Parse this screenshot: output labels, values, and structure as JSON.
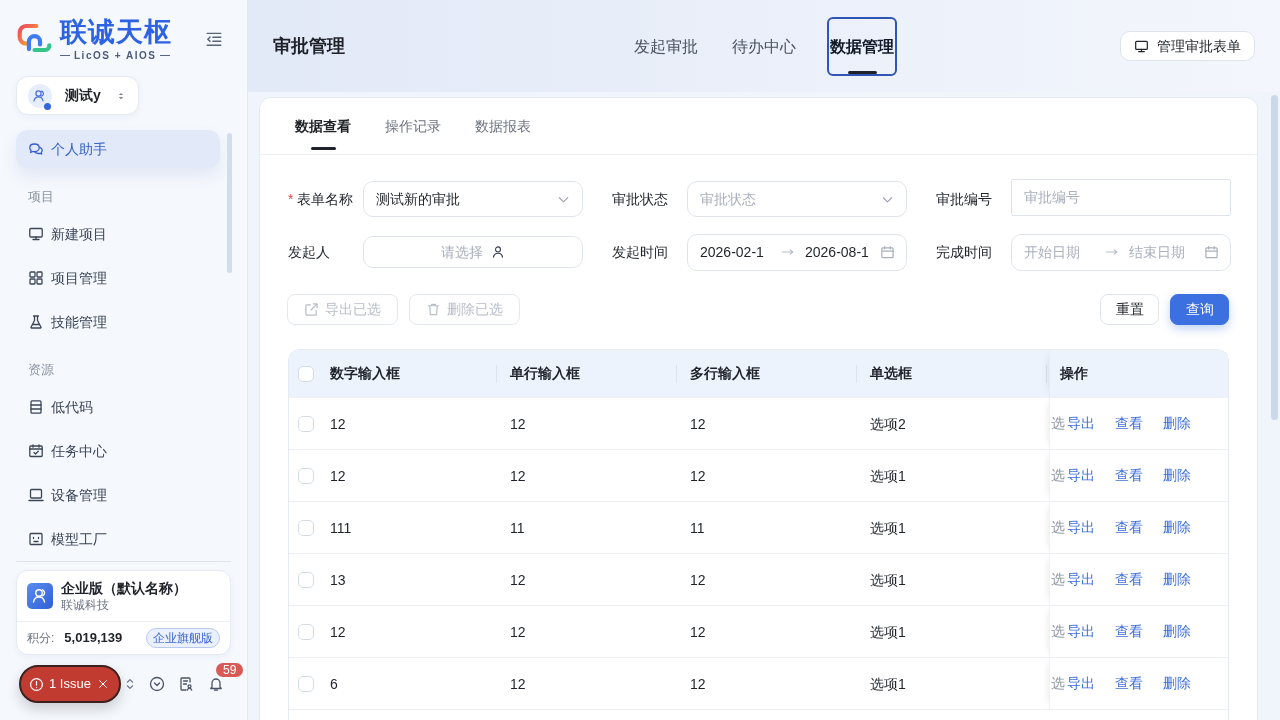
{
  "sidebar": {
    "logo": {
      "name": "联诚天枢",
      "tagline": "LicOS + AIOS"
    },
    "workspace": {
      "name": "测试y",
      "online": true
    },
    "nav": [
      {
        "kind": "item",
        "label": "个人助手",
        "selected": true
      },
      {
        "kind": "section",
        "label": "项目"
      },
      {
        "kind": "item",
        "label": "新建项目",
        "selected": false
      },
      {
        "kind": "item",
        "label": "项目管理",
        "selected": false
      },
      {
        "kind": "item",
        "label": "技能管理",
        "selected": false
      },
      {
        "kind": "section",
        "label": "资源"
      },
      {
        "kind": "item",
        "label": "低代码",
        "selected": false
      },
      {
        "kind": "item",
        "label": "任务中心",
        "selected": false
      },
      {
        "kind": "item",
        "label": "设备管理",
        "selected": false
      },
      {
        "kind": "item",
        "label": "模型工厂",
        "selected": false
      }
    ],
    "org_card": {
      "title": "企业版（默认名称）",
      "subtitle": "联诚科技",
      "points_label": "积分:",
      "points": "5,019,139",
      "plan": "企业旗舰版"
    },
    "notification_count": "59"
  },
  "issue_badge": {
    "label": "1 Issue"
  },
  "header": {
    "title": "审批管理",
    "tabs": [
      {
        "label": "发起审批",
        "selected": false
      },
      {
        "label": "待办中心",
        "selected": false
      },
      {
        "label": "数据管理",
        "selected": true
      }
    ],
    "action": "管理审批表单"
  },
  "subtabs": [
    {
      "label": "数据查看",
      "selected": true
    },
    {
      "label": "操作记录",
      "selected": false
    },
    {
      "label": "数据报表",
      "selected": false
    }
  ],
  "filters": [
    {
      "kind": "select",
      "required_mark": "*",
      "label": "表单名称",
      "value": "测试新的审批"
    },
    {
      "kind": "select",
      "label": "审批状态",
      "placeholder": "审批状态"
    },
    {
      "kind": "input",
      "label": "审批编号",
      "placeholder": "审批编号"
    },
    {
      "kind": "picker",
      "label": "发起人",
      "placeholder": "请选择"
    },
    {
      "kind": "range",
      "label": "发起时间",
      "start": "2026-02-1",
      "end": "2026-08-1"
    },
    {
      "kind": "range",
      "label": "完成时间",
      "start_placeholder": "开始日期",
      "end_placeholder": "结束日期"
    }
  ],
  "bulk_actions": [
    {
      "kind": "export",
      "label": "导出已选",
      "disabled": true
    },
    {
      "kind": "delete",
      "label": "删除已选",
      "disabled": true
    }
  ],
  "search_actions": [
    {
      "kind": "default",
      "label": "重置"
    },
    {
      "kind": "primary",
      "label": "查询"
    }
  ],
  "table": {
    "all_checked": false,
    "columns": [
      "数字输入框",
      "单行输入框",
      "多行输入框",
      "单选框",
      "操作"
    ],
    "rows": [
      {
        "checked": false,
        "cells": [
          "12",
          "12",
          "12",
          "选项2"
        ],
        "hidden_cell": "选",
        "actions": [
          "导出",
          "查看",
          "删除"
        ]
      },
      {
        "checked": false,
        "cells": [
          "12",
          "12",
          "12",
          "选项1"
        ],
        "hidden_cell": "选",
        "actions": [
          "导出",
          "查看",
          "删除"
        ]
      },
      {
        "checked": false,
        "cells": [
          "111",
          "11",
          "11",
          "选项1"
        ],
        "hidden_cell": "选",
        "actions": [
          "导出",
          "查看",
          "删除"
        ]
      },
      {
        "checked": false,
        "cells": [
          "13",
          "12",
          "12",
          "选项1"
        ],
        "hidden_cell": "选",
        "actions": [
          "导出",
          "查看",
          "删除"
        ]
      },
      {
        "checked": false,
        "cells": [
          "12",
          "12",
          "12",
          "选项1"
        ],
        "hidden_cell": "选",
        "actions": [
          "导出",
          "查看",
          "删除"
        ]
      },
      {
        "checked": false,
        "cells": [
          "6",
          "12",
          "12",
          "选项1"
        ],
        "hidden_cell": "选",
        "actions": [
          "导出",
          "查看",
          "删除"
        ]
      }
    ]
  }
}
